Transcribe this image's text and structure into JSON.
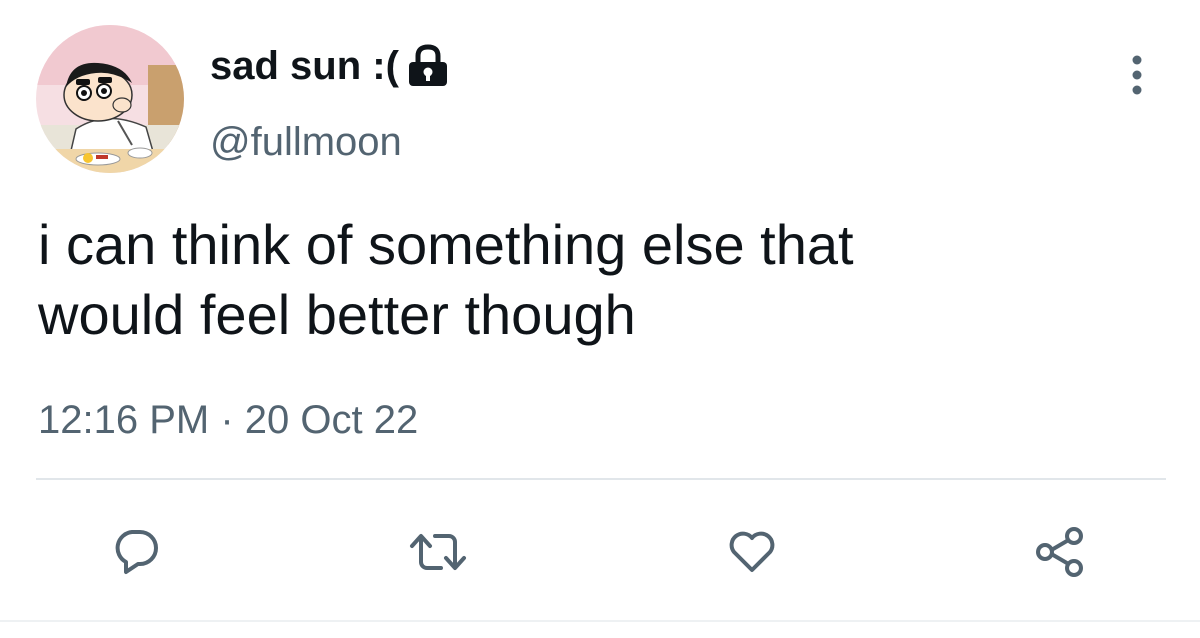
{
  "tweet": {
    "author": {
      "display_name": "sad sun :(",
      "handle": "@fullmoon",
      "protected": true,
      "avatar": "cartoon-boy-eating-avatar"
    },
    "text_lines": [
      "i can think of something else that",
      "would feel better though"
    ],
    "time": "12:16 PM",
    "separator": "·",
    "date": "20 Oct 22"
  },
  "icons": {
    "lock": "lock-icon",
    "more": "more-vertical-icon",
    "reply": "reply-icon",
    "retweet": "retweet-icon",
    "like": "heart-icon",
    "share": "share-icon"
  },
  "colors": {
    "text_primary": "#0f1419",
    "text_secondary": "#536471",
    "divider": "#e1e6ea",
    "background": "#ffffff"
  }
}
